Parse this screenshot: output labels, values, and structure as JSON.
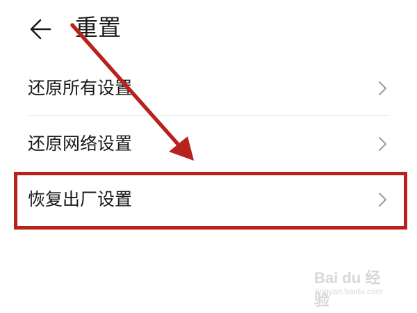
{
  "header": {
    "title": "重置",
    "back_icon": "arrow-left-icon"
  },
  "menu": {
    "items": [
      {
        "label": "还原所有设置",
        "icon": "chevron-right-icon"
      },
      {
        "label": "还原网络设置",
        "icon": "chevron-right-icon"
      },
      {
        "label": "恢复出厂设置",
        "icon": "chevron-right-icon"
      }
    ]
  },
  "annotation": {
    "color": "#b8221c",
    "highlighted_item": "恢复出厂设置"
  },
  "watermark": {
    "brand": "Bai du 经验",
    "url": "jingyan.baidu.com"
  }
}
